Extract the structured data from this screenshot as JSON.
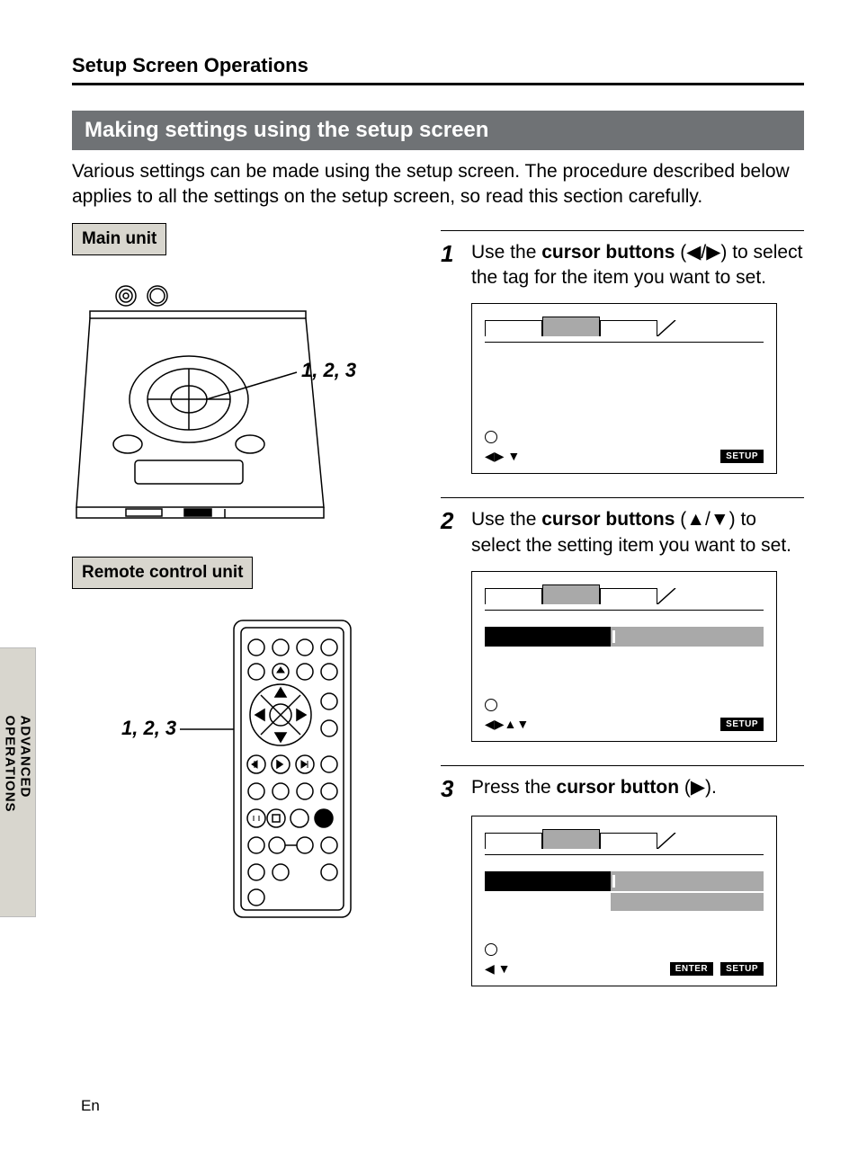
{
  "section_header": "Setup Screen Operations",
  "title_bar": "Making settings using the setup screen",
  "intro": "Various settings can be made using the setup screen.  The procedure described below applies to all the settings on the setup screen, so read this section carefully.",
  "labels": {
    "main_unit": "Main unit",
    "remote_unit": "Remote control unit",
    "leader_main": "1, 2, 3",
    "leader_remote": "1, 2, 3"
  },
  "steps": [
    {
      "num": "1",
      "pre": "Use the ",
      "bold": "cursor buttons",
      "symbols": " (◀/▶)",
      "post": " to select the tag for the item you want to set."
    },
    {
      "num": "2",
      "pre": "Use the ",
      "bold": "cursor buttons",
      "symbols": " (▲/▼)",
      "post": " to select the setting item you want to set."
    },
    {
      "num": "3",
      "pre": "Press the ",
      "bold": "cursor button",
      "symbols": " (▶).",
      "post": ""
    }
  ],
  "osd": {
    "badge_setup": "SETUP",
    "badge_enter": "ENTER",
    "foot1_icons": "◀▶  ▼",
    "foot2_icons": "◀▶▲▼",
    "foot3_icons": "◀    ▼"
  },
  "side_tab": "ADVANCED OPERATIONS",
  "footer": "En"
}
